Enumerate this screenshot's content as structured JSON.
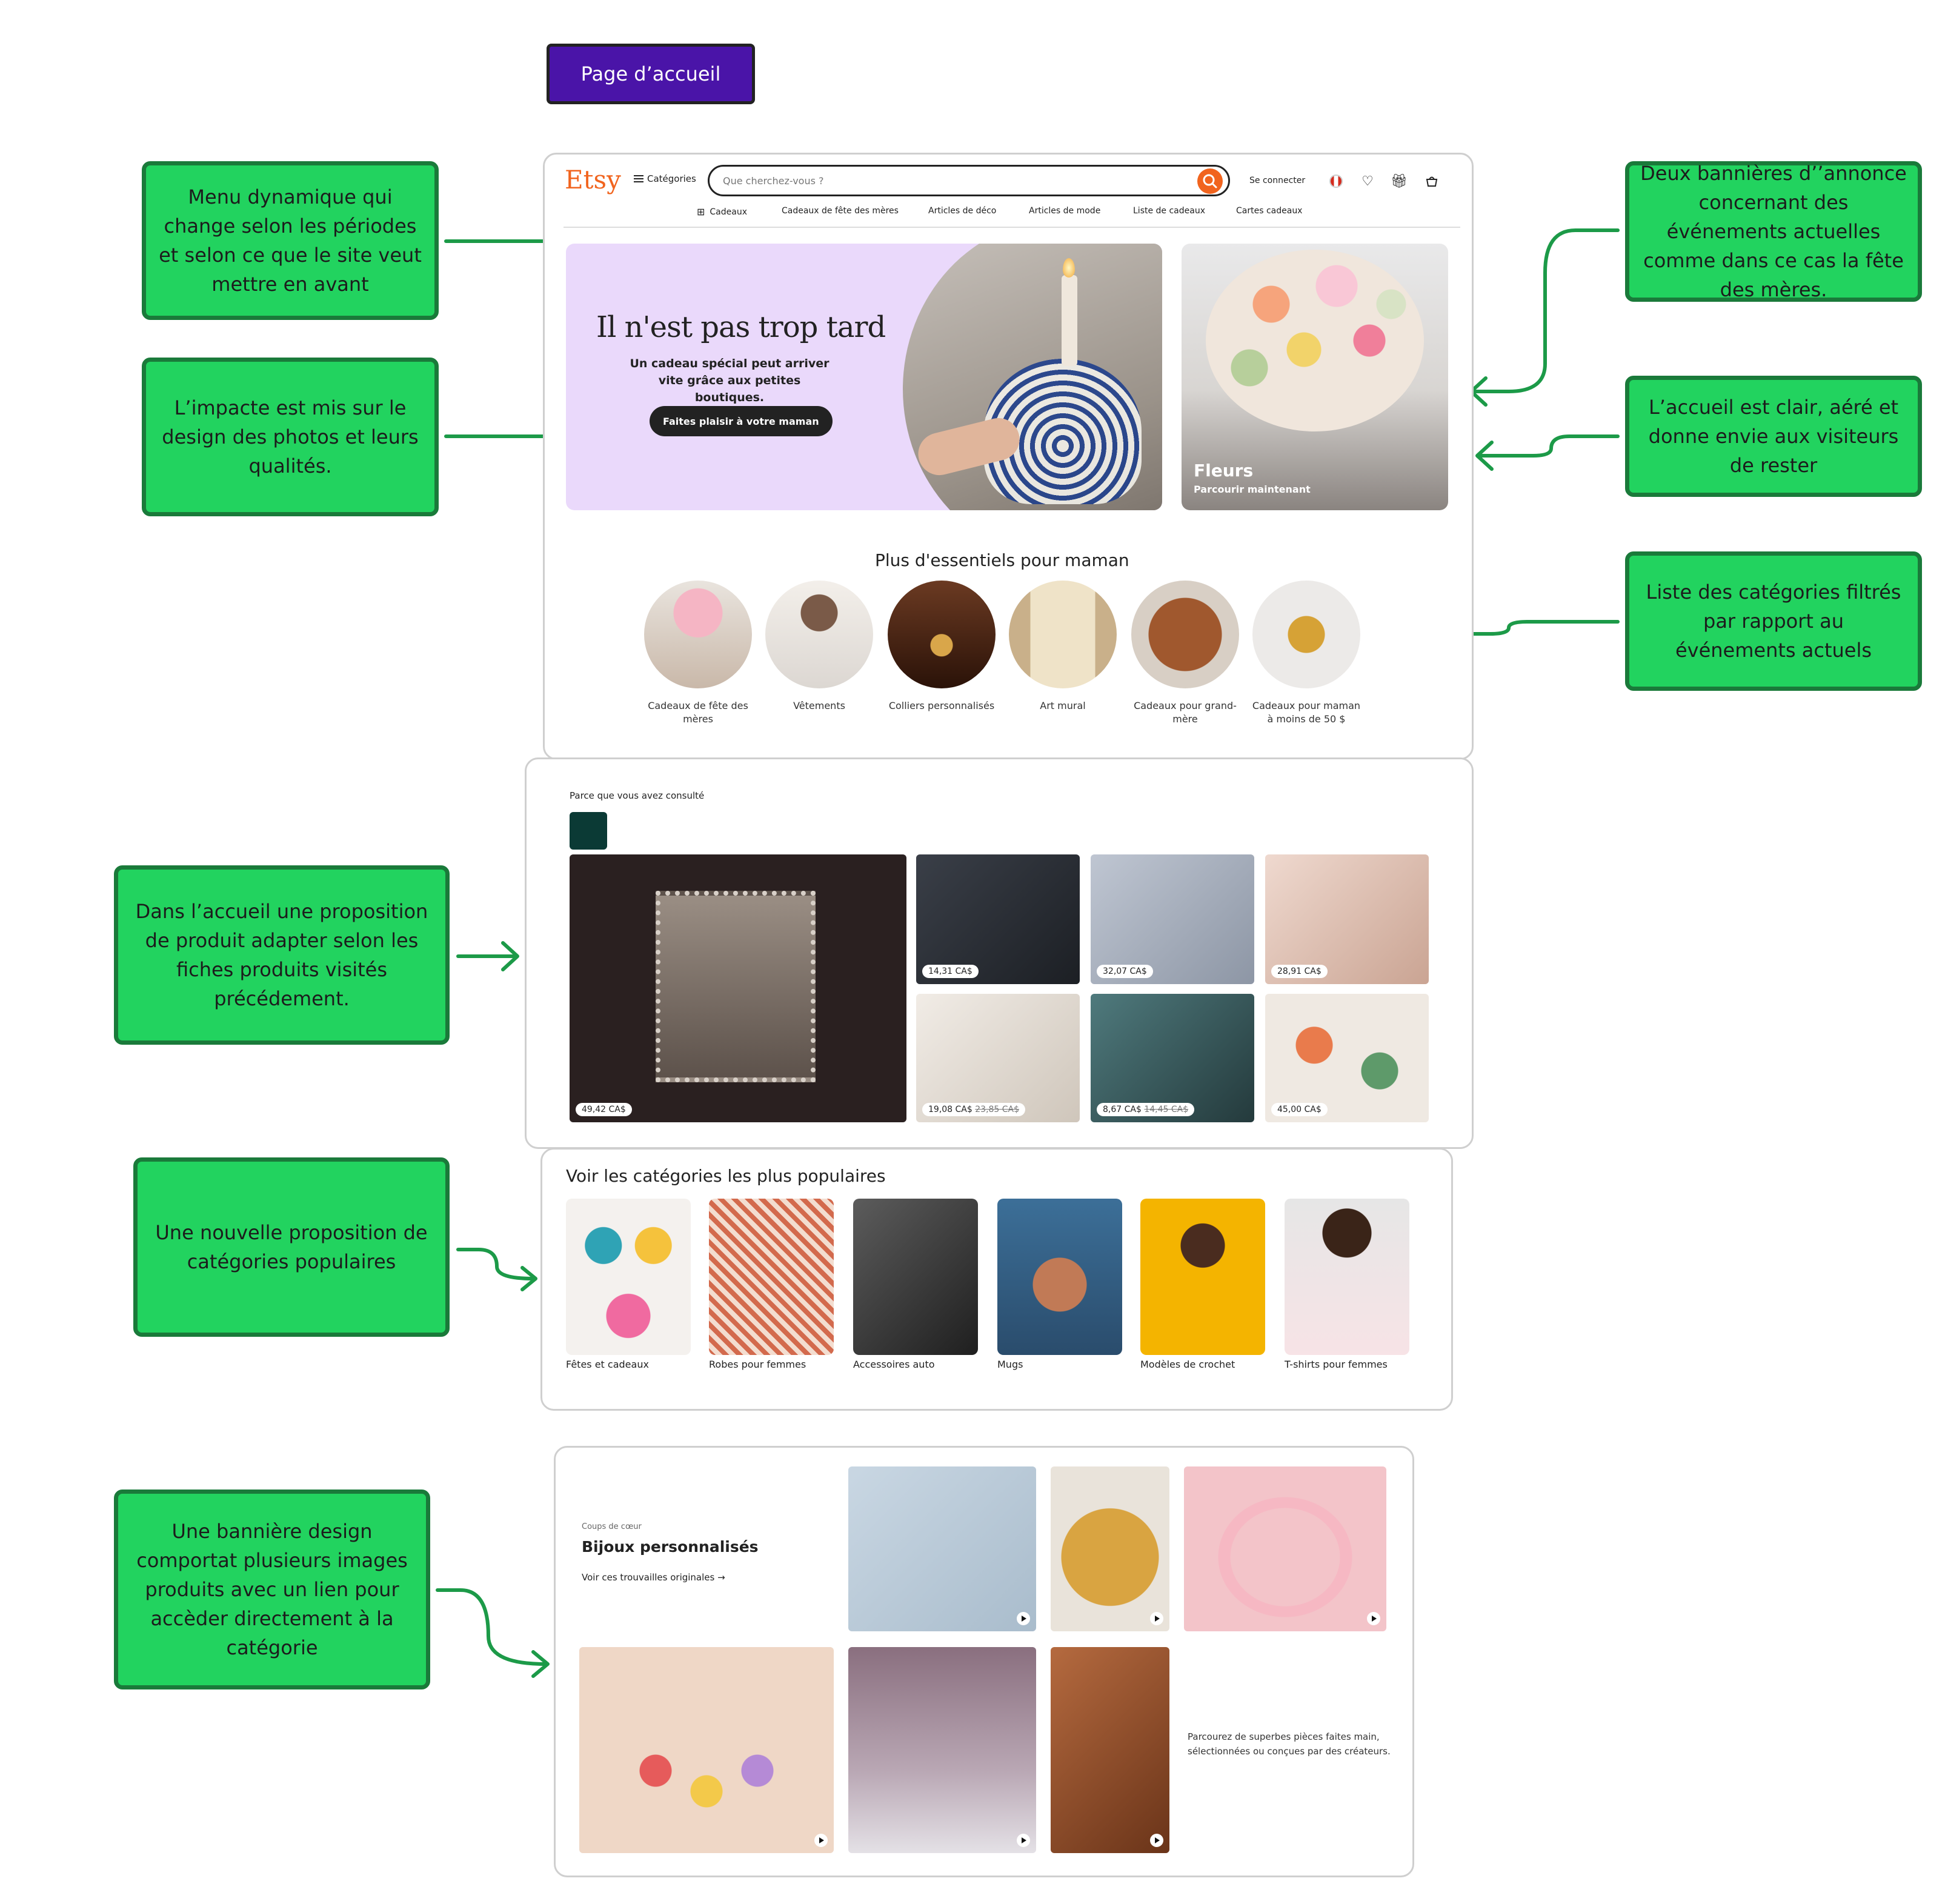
{
  "page_title": "Page d’accueil",
  "colors": {
    "accent_purple": "#4a14a8",
    "note_green": "#22d35f",
    "note_border": "#1a7a3a",
    "etsy_orange": "#f1641e"
  },
  "annotations": [
    "Menu dynamique qui change selon les périodes et selon ce que le site veut mettre en avant",
    "L’impacte est mis sur le design des photos et leurs qualités.",
    "Deux bannières d’’annonce concernant des événements actuelles comme dans ce cas la fête des mères.",
    "L’accueil est clair, aéré et donne envie aux visiteurs de rester",
    "Liste des catégories filtrés par rapport au événements actuels",
    "Dans l’accueil une proposition de produit adapter selon les fiches produits visités précédement.",
    "Une nouvelle proposition de catégories populaires",
    "Une bannière design comportat plusieurs images produits avec un lien pour accèder directement à la catégorie"
  ],
  "header": {
    "logo": "Etsy",
    "categories": "Catégories",
    "search_placeholder": "Que cherchez-vous ?",
    "sign_in": "Se connecter",
    "icons": [
      "search-icon",
      "flag-icon",
      "heart-icon",
      "gift-icon",
      "cart-icon"
    ],
    "nav": [
      "Cadeaux",
      "Cadeaux de fête des mères",
      "Articles de déco",
      "Articles de mode",
      "Liste de cadeaux",
      "Cartes cadeaux"
    ]
  },
  "hero": {
    "title": "Il n'est pas trop tard",
    "subtitle": "Un cadeau spécial peut arriver vite grâce aux petites boutiques.",
    "button": "Faites plaisir à votre maman"
  },
  "side_banner": {
    "title": "Fleurs",
    "subtitle": "Parcourir maintenant"
  },
  "essentials": {
    "title": "Plus d'essentiels pour maman",
    "items": [
      "Cadeaux de fête des mères",
      "Vêtements",
      "Colliers personnalisés",
      "Art mural",
      "Cadeaux pour grand-mère",
      "Cadeaux pour maman à moins de 50 $"
    ]
  },
  "recently_viewed": {
    "label": "Parce que vous avez consulté",
    "items": [
      {
        "price": "49,42 CA$",
        "old_price": ""
      },
      {
        "price": "14,31 CA$",
        "old_price": ""
      },
      {
        "price": "32,07 CA$",
        "old_price": ""
      },
      {
        "price": "28,91 CA$",
        "old_price": ""
      },
      {
        "price": "19,08 CA$",
        "old_price": "23,85 CA$"
      },
      {
        "price": "8,67 CA$",
        "old_price": "14,45 CA$"
      },
      {
        "price": "45,00 CA$",
        "old_price": ""
      }
    ]
  },
  "popular": {
    "title": "Voir les catégories les plus populaires",
    "items": [
      "Fêtes et cadeaux",
      "Robes pour femmes",
      "Accessoires auto",
      "Mugs",
      "Modèles de crochet",
      "T-shirts pour femmes"
    ]
  },
  "jewelry": {
    "small": "Coups de cœur",
    "title": "Bijoux personnalisés",
    "link": "Voir ces trouvailles originales",
    "description": "Parcourez de superbes pièces faites main, sélectionnées ou conçues par des créateurs."
  }
}
